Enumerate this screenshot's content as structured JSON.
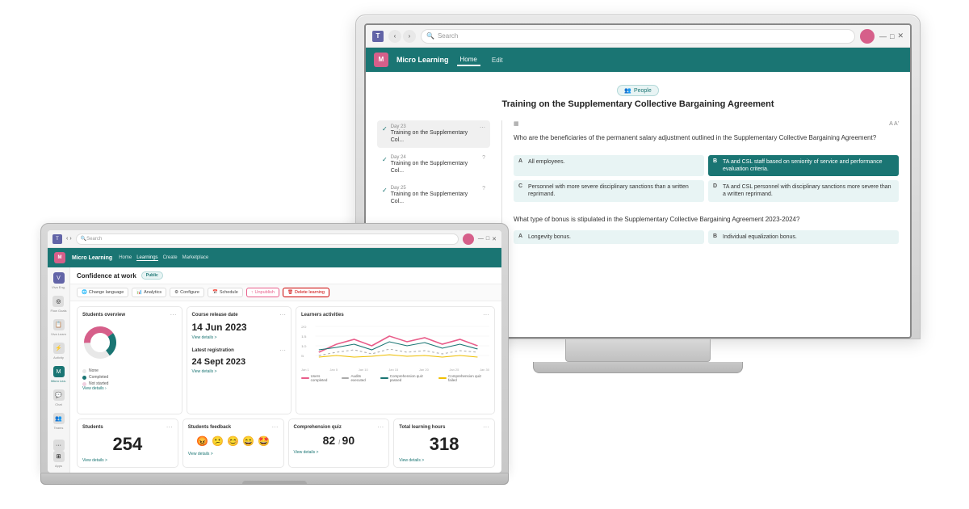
{
  "scene": {
    "background": "#ffffff"
  },
  "desktop": {
    "titlebar": {
      "search_placeholder": "Search",
      "nav_back": "‹",
      "nav_forward": "›"
    },
    "navbar": {
      "logo": "Micro Learning",
      "nav_items": [
        "Home",
        "Edit"
      ]
    },
    "content": {
      "people_badge": "People",
      "main_title": "Training on the Supplementary Collective Bargaining Agreement",
      "days": [
        {
          "label": "Day 23",
          "title": "Training on the Supplementary Col...",
          "active": true
        },
        {
          "label": "Day 24",
          "title": "Training on the Supplementary Col..."
        },
        {
          "label": "Day 25",
          "title": "Training on the Supplementary Col..."
        }
      ],
      "quiz": {
        "question": "Who are the beneficiaries of the permanent salary adjustment outlined in the Supplementary Collective Bargaining Agreement?",
        "question2": "What type of bonus is stipulated in the Supplementary Collective Bargaining Agreement 2023-2024?",
        "options": [
          {
            "letter": "A",
            "text": "All employees.",
            "highlight": false
          },
          {
            "letter": "B",
            "text": "TA and CSL staff based on seniority of service and performance evaluation criteria.",
            "highlight": true
          },
          {
            "letter": "C",
            "text": "Personnel with more severe disciplinary sanctions than a written reprimand.",
            "highlight": false
          },
          {
            "letter": "D",
            "text": "TA and CSL personnel with disciplinary sanctions more severe than a written reprimand.",
            "highlight": false
          }
        ],
        "options2": [
          {
            "letter": "A",
            "text": "Longevity bonus.",
            "highlight": false
          },
          {
            "letter": "B",
            "text": "Individual equalization bonus.",
            "highlight": false
          }
        ]
      }
    }
  },
  "laptop": {
    "titlebar": {
      "search_placeholder": "Search"
    },
    "navbar": {
      "logo": "Micro Learning",
      "nav_items": [
        {
          "label": "Home",
          "active": false
        },
        {
          "label": "Learnings",
          "active": true
        },
        {
          "label": "Create",
          "active": false
        },
        {
          "label": "Marketplace",
          "active": false
        }
      ]
    },
    "sidebar": {
      "items": [
        {
          "icon": "🏠",
          "label": "Viva Eng."
        },
        {
          "icon": "◎",
          "label": "Flow Goals"
        },
        {
          "icon": "📋",
          "label": "Viva Learn"
        },
        {
          "icon": "⚡",
          "label": "Activity"
        },
        {
          "icon": "📚",
          "label": "Micro Lea."
        },
        {
          "icon": "💬",
          "label": "Chat"
        },
        {
          "icon": "👥",
          "label": "Teams"
        }
      ]
    },
    "course": {
      "title": "Confidence at work",
      "badge": "Public",
      "toolbar": {
        "change_language": "Change language",
        "analytics": "Analytics",
        "configure": "Configure",
        "schedule": "Schedule",
        "unpublish": "Unpublish",
        "delete": "Delete learning"
      }
    },
    "dashboard": {
      "students_overview": {
        "title": "Students overview",
        "legend": [
          {
            "label": "None",
            "color": "#e8e8e8"
          },
          {
            "label": "Completed",
            "color": "#1a7573"
          },
          {
            "label": "Not started",
            "color": "#f0d0e0"
          }
        ]
      },
      "course_release_date": {
        "title": "Course release date",
        "date": "14 Jun 2023",
        "view_details": "View details >"
      },
      "latest_registration": {
        "title": "Latest registration",
        "date": "24 Sept 2023",
        "view_details": "View details >"
      },
      "learners_activities": {
        "title": "Learners activities",
        "legend": [
          {
            "label": "Users completed",
            "color": "#e85d8a"
          },
          {
            "label": "Audits executed",
            "color": "#aaa"
          },
          {
            "label": "Comprehension quiz passed",
            "color": "#1a7573"
          },
          {
            "label": "Comprehension quiz failed",
            "color": "#f0c000"
          }
        ]
      },
      "students": {
        "title": "Students",
        "count": "254",
        "view_details": "View details >"
      },
      "feedback": {
        "title": "Students feedback",
        "emojis": [
          "😡",
          "😕",
          "😊",
          "😄",
          "🤩"
        ],
        "view_details": "View details >"
      },
      "comprehension_quiz": {
        "title": "Comprehension quiz",
        "score": "82",
        "total": "90",
        "view_details": "View details >"
      },
      "total_learning_hours": {
        "title": "Total learning hours",
        "hours": "318",
        "view_details": "View details >"
      }
    }
  }
}
